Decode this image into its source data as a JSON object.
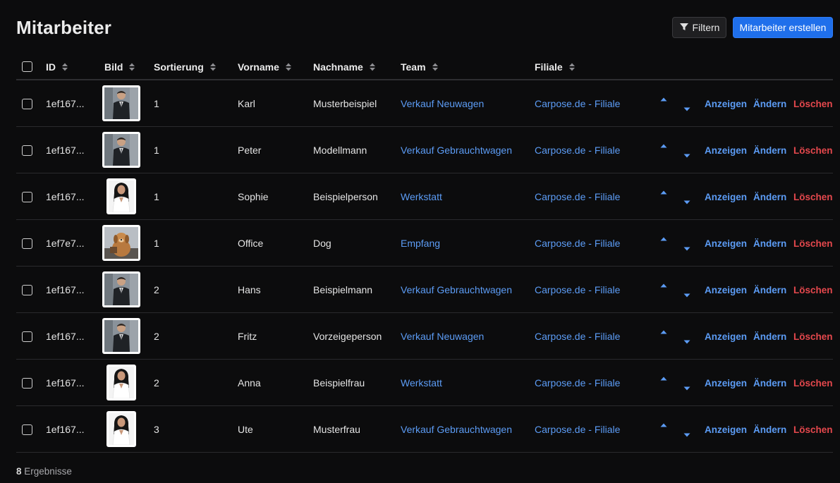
{
  "header": {
    "title": "Mitarbeiter",
    "filter_label": "Filtern",
    "create_label": "Mitarbeiter erstellen"
  },
  "columns": {
    "id": "ID",
    "image": "Bild",
    "sort": "Sortierung",
    "firstname": "Vorname",
    "lastname": "Nachname",
    "team": "Team",
    "branch": "Filiale"
  },
  "actions": {
    "show": "Anzeigen",
    "edit": "Ändern",
    "delete": "Löschen"
  },
  "rows": [
    {
      "id": "1ef167...",
      "photo": "man-suit",
      "sort": "1",
      "firstname": "Karl",
      "lastname": "Musterbeispiel",
      "team": "Verkauf Neuwagen",
      "branch": "Carpose.de - Filiale"
    },
    {
      "id": "1ef167...",
      "photo": "man-suit",
      "sort": "1",
      "firstname": "Peter",
      "lastname": "Modellmann",
      "team": "Verkauf Gebrauchtwagen",
      "branch": "Carpose.de - Filiale"
    },
    {
      "id": "1ef167...",
      "photo": "woman-white",
      "sort": "1",
      "firstname": "Sophie",
      "lastname": "Beispielperson",
      "team": "Werkstatt",
      "branch": "Carpose.de - Filiale"
    },
    {
      "id": "1ef7e7...",
      "photo": "dog",
      "sort": "1",
      "firstname": "Office",
      "lastname": "Dog",
      "team": "Empfang",
      "branch": "Carpose.de - Filiale"
    },
    {
      "id": "1ef167...",
      "photo": "man-suit",
      "sort": "2",
      "firstname": "Hans",
      "lastname": "Beispielmann",
      "team": "Verkauf Gebrauchtwagen",
      "branch": "Carpose.de - Filiale"
    },
    {
      "id": "1ef167...",
      "photo": "man-suit",
      "sort": "2",
      "firstname": "Fritz",
      "lastname": "Vorzeigeperson",
      "team": "Verkauf Neuwagen",
      "branch": "Carpose.de - Filiale"
    },
    {
      "id": "1ef167...",
      "photo": "woman-white",
      "sort": "2",
      "firstname": "Anna",
      "lastname": "Beispielfrau",
      "team": "Werkstatt",
      "branch": "Carpose.de - Filiale"
    },
    {
      "id": "1ef167...",
      "photo": "woman-white",
      "sort": "3",
      "firstname": "Ute",
      "lastname": "Musterfrau",
      "team": "Verkauf Gebrauchtwagen",
      "branch": "Carpose.de - Filiale"
    }
  ],
  "footer": {
    "count": "8",
    "label": "Ergebnisse"
  },
  "colors": {
    "background": "#0c0c0d",
    "primary": "#1f6feb",
    "link": "#5c9cf5",
    "danger": "#e5484d"
  }
}
